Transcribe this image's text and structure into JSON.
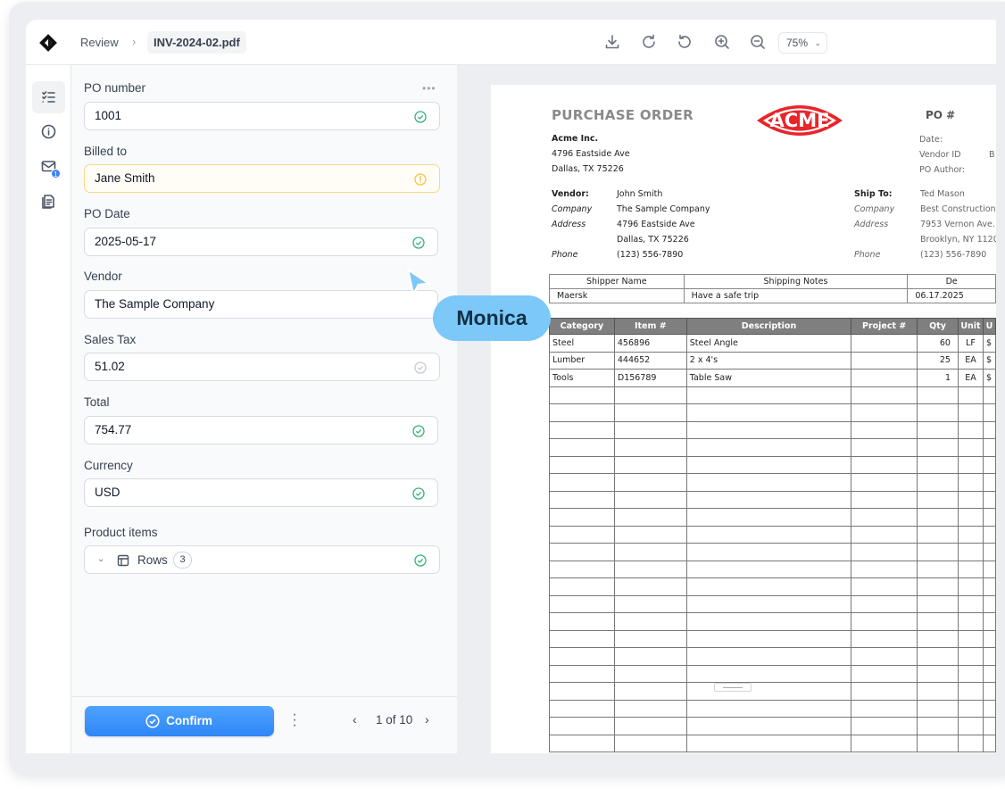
{
  "header": {
    "breadcrumb_root": "Review",
    "file_name": "INV-2024-02.pdf",
    "zoom": "75%",
    "toolbar_icons": [
      "download-icon",
      "rotate-cw-icon",
      "rotate-ccw-icon",
      "zoom-in-icon",
      "zoom-out-icon"
    ]
  },
  "sidebar": {
    "items": [
      {
        "icon": "fields-list-icon",
        "active": true
      },
      {
        "icon": "info-icon",
        "active": false
      },
      {
        "icon": "mail-icon",
        "badge": "1",
        "active": false
      },
      {
        "icon": "document-icon",
        "active": false
      }
    ]
  },
  "form": {
    "fields": [
      {
        "label": "PO number",
        "value": "1001",
        "status": "ok"
      },
      {
        "label": "Billed to",
        "value": "Jane Smith",
        "status": "warning"
      },
      {
        "label": "PO Date",
        "value": "2025-05-17",
        "status": "ok"
      },
      {
        "label": "Vendor",
        "value": "The Sample Company",
        "status": "ok"
      },
      {
        "label": "Sales Tax",
        "value": "51.02",
        "status": "neutral"
      },
      {
        "label": "Total",
        "value": "754.77",
        "status": "ok"
      },
      {
        "label": "Currency",
        "value": "USD",
        "status": "ok"
      }
    ],
    "product_items": {
      "label": "Product items",
      "rows_label": "Rows",
      "rows_count": "3",
      "status": "ok"
    }
  },
  "footer": {
    "confirm_label": "Confirm",
    "pagination": "1 of 10"
  },
  "cursor": {
    "name": "Monica",
    "color": "#7cc8f8"
  },
  "document": {
    "title": "PURCHASE ORDER",
    "logo_text": "ACME",
    "po_hash": "PO #",
    "company": {
      "name": "Acme Inc.",
      "street": "4796 Eastside Ave",
      "city": "Dallas, TX  75226"
    },
    "meta_labels": [
      "Date:",
      "Vendor ID",
      "PO Author:"
    ],
    "meta_value_partial": "B",
    "vendor": {
      "label": "Vendor:",
      "name": "John Smith",
      "company_label": "Company",
      "company": "The Sample Company",
      "address_label": "Address",
      "street": "4796 Eastside Ave",
      "city": "Dallas, TX  75226",
      "phone_label": "Phone",
      "phone": "(123) 556-7890"
    },
    "ship_to": {
      "label": "Ship To:",
      "name": "Ted Mason",
      "company_label": "Company",
      "company": "Best Construction",
      "address_label": "Address",
      "street": "7953 Vernon Ave.",
      "city": "Brooklyn, NY 1120",
      "phone_label": "Phone",
      "phone": "(123) 556-7890"
    },
    "shipping": {
      "headers": [
        "Shipper Name",
        "Shipping Notes",
        "De"
      ],
      "row": [
        "Maersk",
        "Have a safe trip",
        "06.17.2025"
      ]
    },
    "items": {
      "headers": [
        "Category",
        "Item #",
        "Description",
        "Project #",
        "Qty",
        "Unit",
        "U"
      ],
      "rows": [
        [
          "Steel",
          "456896",
          "Steel Angle",
          "",
          "60",
          "LF",
          "$"
        ],
        [
          "Lumber",
          "444652",
          "2 x 4's",
          "",
          "25",
          "EA",
          "$"
        ],
        [
          "Tools",
          "D156789",
          "Table Saw",
          "",
          "1",
          "EA",
          "$"
        ]
      ],
      "empty_rows": 21
    }
  },
  "colors": {
    "accent": "#2f86f6",
    "ok": "#34b27b",
    "warning": "#f5c542",
    "acme_red": "#e8252b"
  }
}
